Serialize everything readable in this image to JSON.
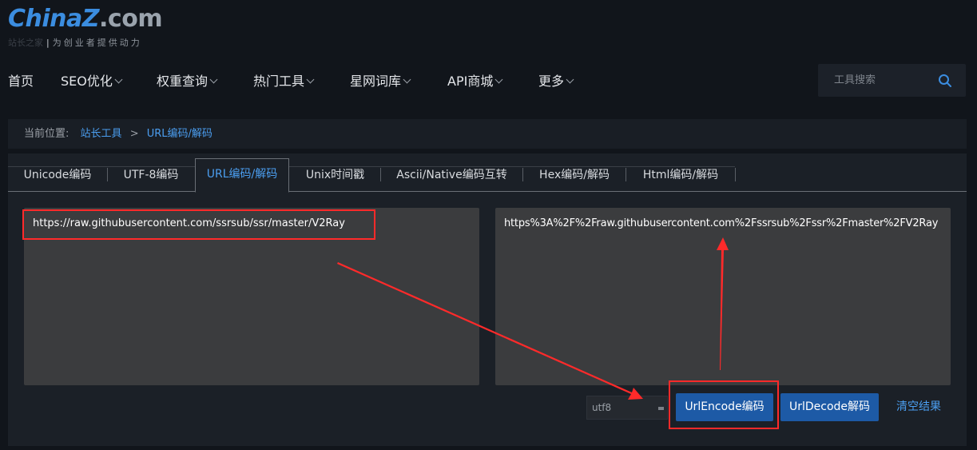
{
  "logo": {
    "brand_main": "China",
    "brand_z": "Z",
    "brand_com": ".com",
    "tagline_dim": "站长之家",
    "tagline": "为创业者提供动力"
  },
  "nav": {
    "items": [
      {
        "label": "首页",
        "dropdown": false
      },
      {
        "label": "SEO优化",
        "dropdown": true
      },
      {
        "label": "权重查询",
        "dropdown": true
      },
      {
        "label": "热门工具",
        "dropdown": true
      },
      {
        "label": "星网词库",
        "dropdown": true
      },
      {
        "label": "API商城",
        "dropdown": true
      },
      {
        "label": "更多",
        "dropdown": true
      }
    ],
    "search_placeholder": "工具搜索",
    "search_icon": "search-icon"
  },
  "breadcrumb": {
    "label": "当前位置:",
    "items": [
      "站长工具",
      "URL编码/解码"
    ],
    "separator": ">"
  },
  "tabs": [
    {
      "label": "Unicode编码",
      "active": false
    },
    {
      "label": "UTF-8编码",
      "active": false
    },
    {
      "label": "URL编码/解码",
      "active": true
    },
    {
      "label": "Unix时间戳",
      "active": false
    },
    {
      "label": "Ascii/Native编码互转",
      "active": false
    },
    {
      "label": "Hex编码/解码",
      "active": false
    },
    {
      "label": "Html编码/解码",
      "active": false
    }
  ],
  "input_text": "https://raw.githubusercontent.com/ssrsub/ssr/master/V2Ray",
  "output_text": "https%3A%2F%2Fraw.githubusercontent.com%2Fssrsub%2Fssr%2Fmaster%2FV2Ray",
  "charset": {
    "selected": "utf8"
  },
  "buttons": {
    "encode": "UrlEncode编码",
    "decode": "UrlDecode解码",
    "clear": "清空结果"
  },
  "colors": {
    "accent": "#4b9ef0",
    "button": "#1d5aa6",
    "annotation": "#ff2a2a",
    "background": "#11151b"
  }
}
